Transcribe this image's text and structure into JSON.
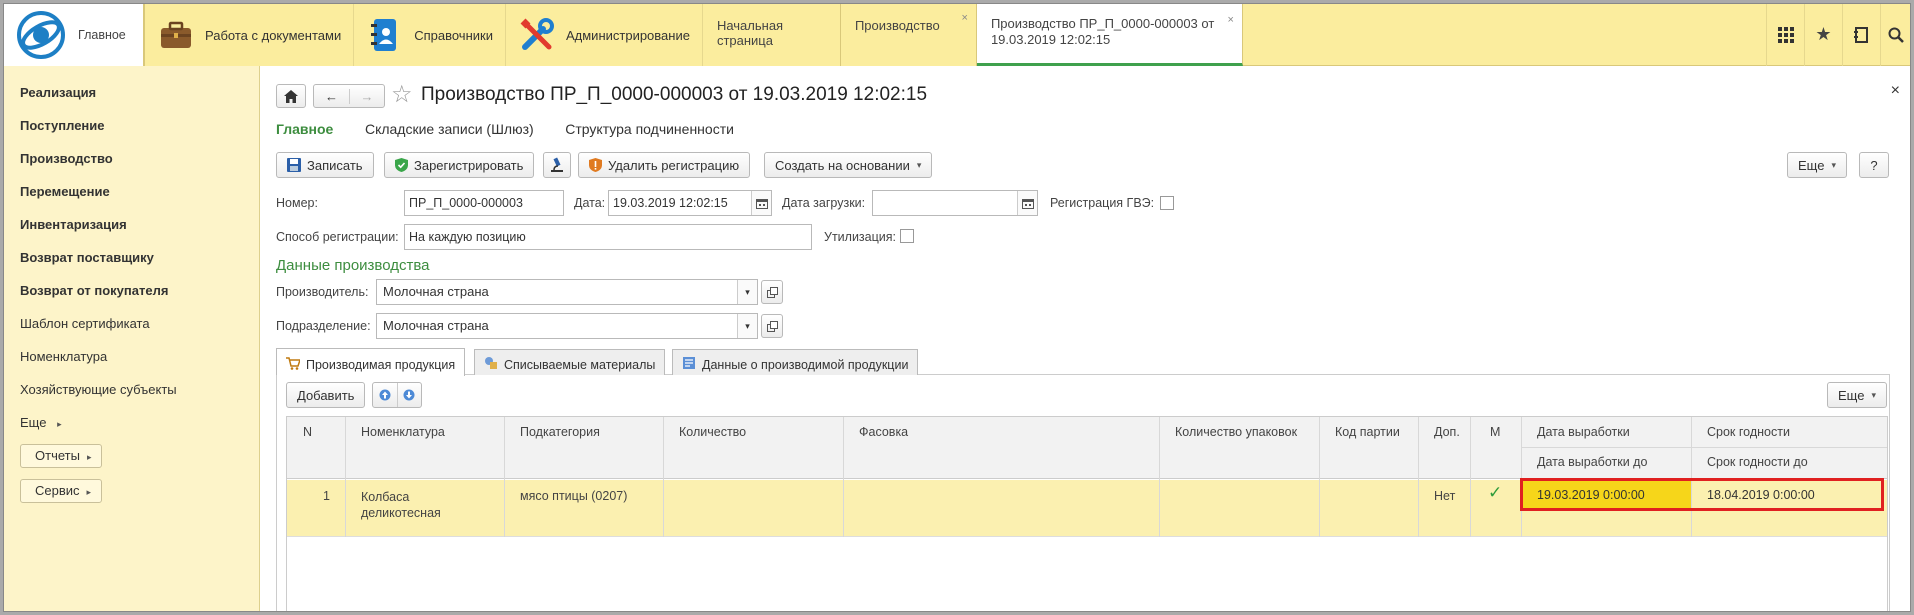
{
  "topbar": {
    "main_label": "Главное",
    "sections": [
      {
        "label": "Работа с документами"
      },
      {
        "label": "Справочники"
      },
      {
        "label": "Администрирование"
      }
    ],
    "open_tabs": [
      {
        "label": "Начальная страница"
      },
      {
        "label": "Производство"
      },
      {
        "label_line1": "Производство ПР_П_0000-000003 от",
        "label_line2": "19.03.2019 12:02:15"
      }
    ],
    "close_glyph": "×"
  },
  "leftnav": {
    "bold_items": [
      "Реализация",
      "Поступление",
      "Производство",
      "Перемещение",
      "Инвентаризация",
      "Возврат поставщику",
      "Возврат от покупателя"
    ],
    "items": [
      "Шаблон сертификата",
      "Номенклатура",
      "Хозяйствующие субъекты"
    ],
    "more": "Еще",
    "reports": "Отчеты",
    "service": "Сервис"
  },
  "document": {
    "title": "Производство ПР_П_0000-000003 от 19.03.2019 12:02:15",
    "close": "×",
    "tabs": [
      "Главное",
      "Складские записи (Шлюз)",
      "Структура подчиненности"
    ],
    "toolbar": {
      "save": "Записать",
      "register": "Зарегистрировать",
      "delete_reg": "Удалить регистрацию",
      "create_based": "Создать на основании",
      "more": "Еще",
      "help": "?"
    },
    "fields": {
      "number_label": "Номер:",
      "number_value": "ПР_П_0000-000003",
      "date_label": "Дата:",
      "date_value": "19.03.2019 12:02:15",
      "load_date_label": "Дата загрузки:",
      "load_date_value": " .  .       :  :",
      "gve_label": "Регистрация ГВЭ:",
      "method_label": "Способ регистрации:",
      "method_value": "На каждую позицию",
      "utilization_label": "Утилизация:"
    },
    "production_title": "Данные производства",
    "producer_label": "Производитель:",
    "producer_value": "Молочная страна",
    "division_label": "Подразделение:",
    "division_value": "Молочная страна",
    "subtabs": [
      "Производимая продукция",
      "Списываемые материалы",
      "Данные о производимой продукции"
    ],
    "table_toolbar": {
      "add": "Добавить",
      "more": "Еще"
    },
    "table": {
      "headers": [
        "N",
        "Номенклатура",
        "Подкатегория",
        "Количество",
        "Фасовка",
        "Количество упаковок",
        "Код партии",
        "Доп.",
        "М",
        "Дата выработки",
        "Срок годности"
      ],
      "subheaders": {
        "date_to": "Дата выработки до",
        "expiry_to": "Срок годности до"
      },
      "rows": [
        {
          "n": "1",
          "nomenclature_1": "Колбаса",
          "nomenclature_2": "деликотесная",
          "subcategory": "мясо птицы (0207)",
          "qty": "",
          "packing": "",
          "packs": "",
          "batch": "",
          "extra": "Нет",
          "m": "✓",
          "prod_date": "19.03.2019 0:00:00",
          "expiry": "18.04.2019 0:00:00"
        }
      ]
    }
  }
}
